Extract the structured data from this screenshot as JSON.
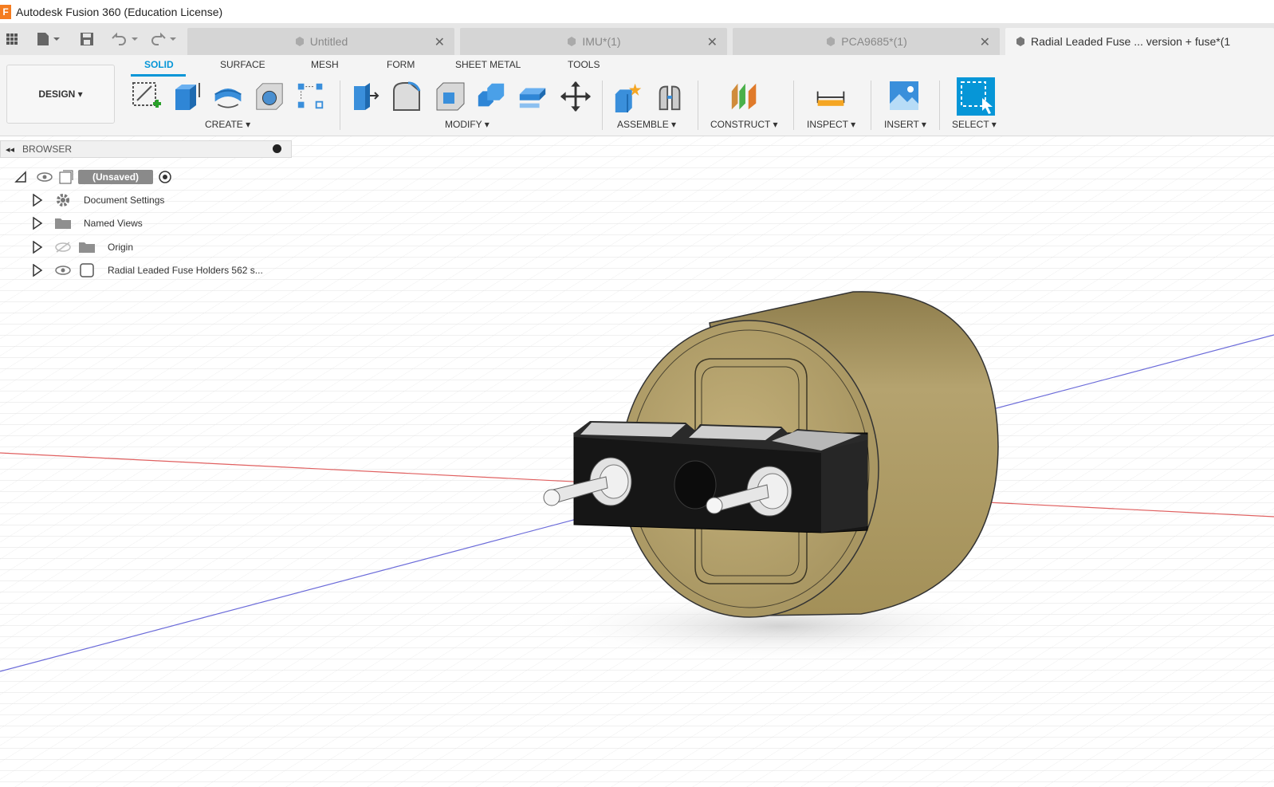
{
  "titlebar": {
    "title": "Autodesk Fusion 360 (Education License)"
  },
  "tabs": [
    {
      "label": "Untitled"
    },
    {
      "label": "IMU*(1)"
    },
    {
      "label": "PCA9685*(1)"
    },
    {
      "label": "Radial Leaded Fuse ... version + fuse*(1"
    }
  ],
  "ribbon": {
    "workspace": "DESIGN ▾",
    "tabs": [
      "SOLID",
      "SURFACE",
      "MESH",
      "FORM",
      "SHEET METAL",
      "TOOLS"
    ],
    "groups": {
      "create": "CREATE ▾",
      "modify": "MODIFY ▾",
      "assemble": "ASSEMBLE ▾",
      "construct": "CONSTRUCT ▾",
      "inspect": "INSPECT ▾",
      "insert": "INSERT ▾",
      "select": "SELECT ▾"
    }
  },
  "browser": {
    "title": "BROWSER",
    "root": "(Unsaved)",
    "items": [
      {
        "label": "Document Settings",
        "icon": "gear-icon"
      },
      {
        "label": "Named Views",
        "icon": "folder-icon"
      },
      {
        "label": "Origin",
        "icon": "folder-icon"
      },
      {
        "label": "Radial Leaded Fuse Holders 562 s...",
        "icon": "component-icon"
      }
    ]
  },
  "colors": {
    "accent": "#0696d7",
    "model_body": "#b3a06a",
    "terminal_block": "#1a1a1a",
    "x_axis": "#e06060",
    "z_axis": "#6b6bd9"
  }
}
